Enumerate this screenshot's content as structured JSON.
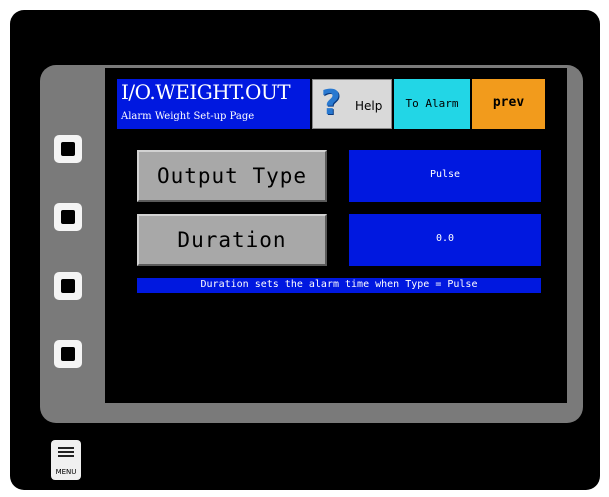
{
  "header": {
    "title": "I/O.WEIGHT.OUT",
    "subtitle": "Alarm Weight Set-up Page"
  },
  "toolbar": {
    "help_label": "Help",
    "help_icon": "question-mark-icon",
    "to_alarm_label": "To Alarm",
    "prev_label": "prev"
  },
  "fields": {
    "output_type": {
      "label": "Output Type",
      "value": "Pulse"
    },
    "duration": {
      "label": "Duration",
      "value": "0.0"
    }
  },
  "info": {
    "text": "Duration sets the alarm time when Type = Pulse"
  },
  "menu": {
    "label": "MENU"
  },
  "colors": {
    "title_bg": "#0018e0",
    "to_alarm_bg": "#22d6e6",
    "prev_bg": "#f29b1c",
    "field_bg": "#a8a8a8",
    "bezel": "#7a7a7a"
  }
}
